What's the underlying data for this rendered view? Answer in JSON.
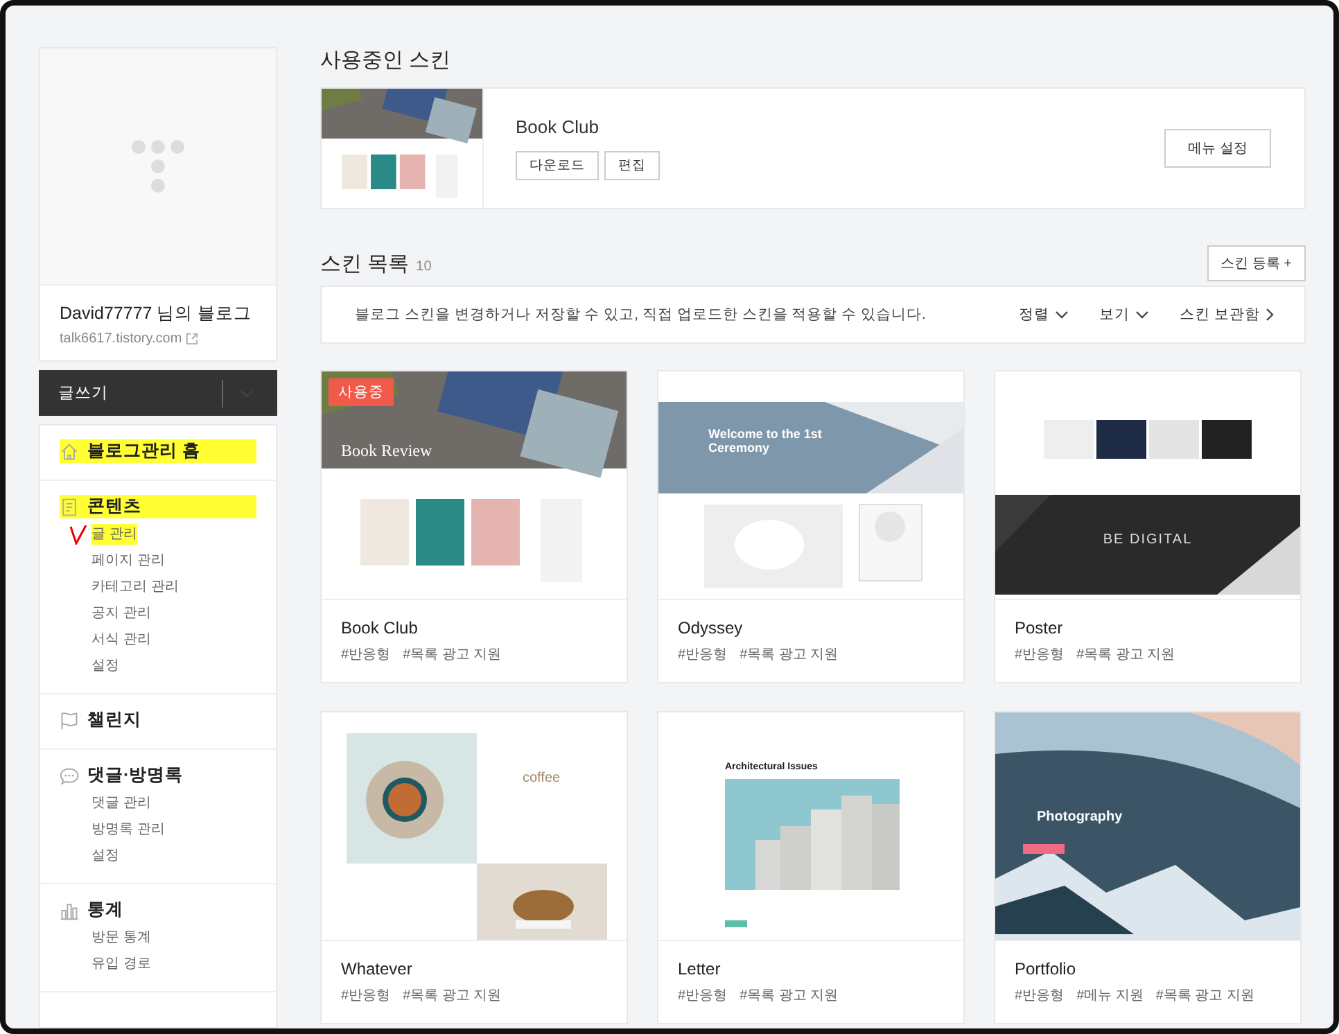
{
  "sidebar": {
    "blog_name": "David77777 님의 블로그",
    "blog_url": "talk6617.tistory.com",
    "write_button": "글쓰기",
    "sections": [
      {
        "kind": "home",
        "title": "블로그관리 홈",
        "highlighted": true
      },
      {
        "kind": "document",
        "title": "콘텐츠",
        "highlighted": true,
        "items": [
          {
            "label": "글 관리",
            "highlighted": true,
            "marked": true
          },
          {
            "label": "페이지 관리",
            "highlighted": false,
            "marked": false
          },
          {
            "label": "카테고리 관리",
            "highlighted": false,
            "marked": false
          },
          {
            "label": "공지 관리",
            "highlighted": false,
            "marked": false
          },
          {
            "label": "서식 관리",
            "highlighted": false,
            "marked": false
          },
          {
            "label": "설정",
            "highlighted": false,
            "marked": false
          }
        ]
      },
      {
        "kind": "flag",
        "title": "챌린지",
        "highlighted": false
      },
      {
        "kind": "chat",
        "title": "댓글·방명록",
        "highlighted": false,
        "items": [
          {
            "label": "댓글 관리",
            "highlighted": false,
            "marked": false
          },
          {
            "label": "방명록 관리",
            "highlighted": false,
            "marked": false
          },
          {
            "label": "설정",
            "highlighted": false,
            "marked": false
          }
        ]
      },
      {
        "kind": "chart",
        "title": "통계",
        "highlighted": false,
        "items": [
          {
            "label": "방문 통계",
            "highlighted": false,
            "marked": false
          },
          {
            "label": "유입 경로",
            "highlighted": false,
            "marked": false
          }
        ]
      }
    ]
  },
  "current_skin": {
    "heading": "사용중인 스킨",
    "name": "Book Club",
    "buttons": [
      "다운로드",
      "편집"
    ],
    "menu_button": "메뉴 설정"
  },
  "skin_list": {
    "heading": "스킨 목록",
    "count": "10",
    "add_button": "스킨 등록 +",
    "notice": "블로그 스킨을 변경하거나 저장할 수 있고, 직접 업로드한 스킨을 적용할 수 있습니다.",
    "sort": "정렬",
    "view": "보기",
    "storage": "스킨 보관함",
    "skins": [
      {
        "name": "Book Club",
        "tags": [
          "#반응형",
          "#목록 광고 지원"
        ],
        "in_use": true,
        "badge": "사용중",
        "caption": "Book Review"
      },
      {
        "name": "Odyssey",
        "tags": [
          "#반응형",
          "#목록 광고 지원"
        ],
        "in_use": false,
        "caption": "Welcome to the 1st Ceremony"
      },
      {
        "name": "Poster",
        "tags": [
          "#반응형",
          "#목록 광고 지원"
        ],
        "in_use": false,
        "caption": "BE DIGITAL"
      },
      {
        "name": "Whatever",
        "tags": [
          "#반응형",
          "#목록 광고 지원"
        ],
        "in_use": false,
        "caption": "coffee"
      },
      {
        "name": "Letter",
        "tags": [
          "#반응형",
          "#목록 광고 지원"
        ],
        "in_use": false,
        "caption": "Architectural Issues"
      },
      {
        "name": "Portfolio",
        "tags": [
          "#반응형",
          "#메뉴 지원",
          "#목록 광고 지원"
        ],
        "in_use": false,
        "caption": "Photography"
      }
    ]
  }
}
